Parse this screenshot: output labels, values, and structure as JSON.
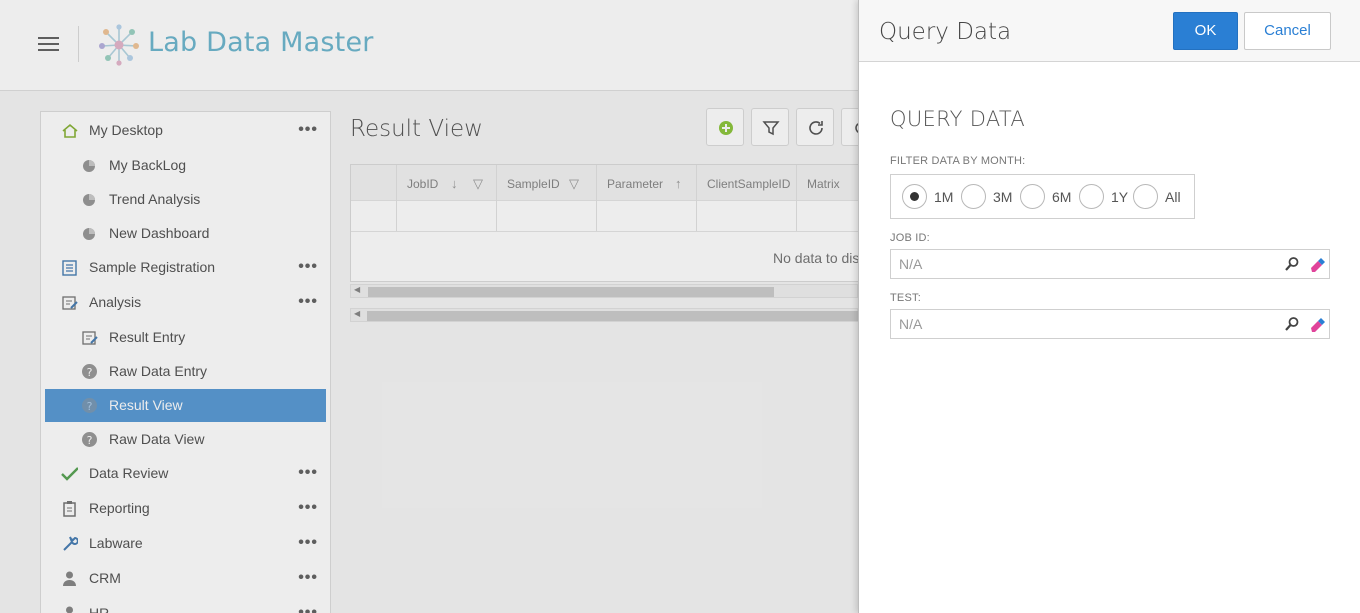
{
  "app": {
    "title": "Lab Data Master",
    "menu_icon": "hamburger-menu-icon",
    "logo_icon": "molecule-logo-icon"
  },
  "sidebar": {
    "items": [
      {
        "label": "My Desktop",
        "icon": "home-icon",
        "level": "top",
        "has_menu": true
      },
      {
        "label": "My BackLog",
        "icon": "pie-chart-icon",
        "level": "sub",
        "has_menu": false
      },
      {
        "label": "Trend Analysis",
        "icon": "pie-chart-icon",
        "level": "sub",
        "has_menu": false
      },
      {
        "label": "New Dashboard",
        "icon": "pie-chart-icon",
        "level": "sub",
        "has_menu": false
      },
      {
        "label": "Sample Registration",
        "icon": "form-icon",
        "level": "top",
        "has_menu": true
      },
      {
        "label": "Analysis",
        "icon": "edit-form-icon",
        "level": "top",
        "has_menu": true
      },
      {
        "label": "Result Entry",
        "icon": "edit-form-icon",
        "level": "sub",
        "has_menu": false
      },
      {
        "label": "Raw Data Entry",
        "icon": "help-circle-icon",
        "level": "sub",
        "has_menu": false
      },
      {
        "label": "Result View",
        "icon": "help-circle-icon",
        "level": "sub",
        "has_menu": false,
        "active": true
      },
      {
        "label": "Raw Data View",
        "icon": "help-circle-icon",
        "level": "sub",
        "has_menu": false
      },
      {
        "label": "Data Review",
        "icon": "checkmark-icon",
        "level": "top",
        "has_menu": true
      },
      {
        "label": "Reporting",
        "icon": "clipboard-icon",
        "level": "top",
        "has_menu": true
      },
      {
        "label": "Labware",
        "icon": "wrench-icon",
        "level": "top",
        "has_menu": true
      },
      {
        "label": "CRM",
        "icon": "user-icon",
        "level": "top",
        "has_menu": true
      },
      {
        "label": "HR",
        "icon": "user-icon",
        "level": "top",
        "has_menu": true
      }
    ],
    "more_glyph": "•••"
  },
  "main": {
    "title": "Result View",
    "toolbar_icons": [
      "add-circle-icon",
      "filter-icon",
      "refresh-icon",
      "more-tools-icon"
    ],
    "grid": {
      "columns": [
        "JobID",
        "SampleID",
        "Parameter",
        "ClientSampleID",
        "Matrix"
      ],
      "empty_text": "No data to dis"
    }
  },
  "dialog": {
    "header_title": "Query Data",
    "ok_label": "OK",
    "cancel_label": "Cancel",
    "section_title": "QUERY DATA",
    "month_filter": {
      "label": "FILTER DATA BY MONTH:",
      "options": [
        "1M",
        "3M",
        "6M",
        "1Y",
        "All"
      ],
      "selected": "1M"
    },
    "job_id": {
      "label": "JOB ID:",
      "placeholder": "N/A"
    },
    "test": {
      "label": "TEST:",
      "placeholder": "N/A"
    },
    "colors": {
      "primary": "#2a7fd4",
      "clear_icon": "#e0449b"
    }
  }
}
